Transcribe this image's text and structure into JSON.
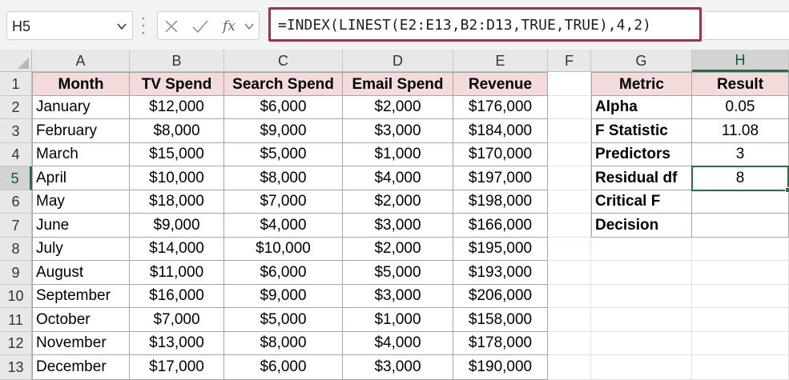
{
  "name_box": {
    "value": "H5"
  },
  "formula_bar": {
    "formula": "=INDEX(LINEST(E2:E13,B2:D13,TRUE,TRUE),4,2)",
    "fx_label": "fx"
  },
  "columns": [
    "A",
    "B",
    "C",
    "D",
    "E",
    "F",
    "G",
    "H"
  ],
  "rows": [
    "1",
    "2",
    "3",
    "4",
    "5",
    "6",
    "7",
    "8",
    "9",
    "10",
    "11",
    "12",
    "13"
  ],
  "selected_column": "H",
  "selected_row": "5",
  "main_table": {
    "headers": [
      "Month",
      "TV Spend",
      "Search Spend",
      "Email Spend",
      "Revenue"
    ],
    "rows": [
      [
        "January",
        "$12,000",
        "$6,000",
        "$2,000",
        "$176,000"
      ],
      [
        "February",
        "$8,000",
        "$9,000",
        "$3,000",
        "$184,000"
      ],
      [
        "March",
        "$15,000",
        "$5,000",
        "$1,000",
        "$170,000"
      ],
      [
        "April",
        "$10,000",
        "$8,000",
        "$4,000",
        "$197,000"
      ],
      [
        "May",
        "$18,000",
        "$7,000",
        "$2,000",
        "$198,000"
      ],
      [
        "June",
        "$9,000",
        "$4,000",
        "$3,000",
        "$166,000"
      ],
      [
        "July",
        "$14,000",
        "$10,000",
        "$2,000",
        "$195,000"
      ],
      [
        "August",
        "$11,000",
        "$6,000",
        "$5,000",
        "$193,000"
      ],
      [
        "September",
        "$16,000",
        "$9,000",
        "$3,000",
        "$206,000"
      ],
      [
        "October",
        "$7,000",
        "$5,000",
        "$1,000",
        "$158,000"
      ],
      [
        "November",
        "$13,000",
        "$8,000",
        "$4,000",
        "$178,000"
      ],
      [
        "December",
        "$17,000",
        "$6,000",
        "$3,000",
        "$190,000"
      ]
    ]
  },
  "metric_table": {
    "headers": [
      "Metric",
      "Result"
    ],
    "rows": [
      [
        "Alpha",
        "0.05"
      ],
      [
        "F Statistic",
        "11.08"
      ],
      [
        "Predictors",
        "3"
      ],
      [
        "Residual df",
        "8"
      ],
      [
        "Critical F",
        ""
      ],
      [
        "Decision",
        ""
      ]
    ]
  },
  "colors": {
    "header_fill": "#f3dbdb",
    "formula_highlight": "#cc1f3f",
    "selection_green": "#217346"
  },
  "icons": [
    "chevron-down-icon",
    "cancel-icon",
    "enter-icon",
    "function-icon"
  ]
}
